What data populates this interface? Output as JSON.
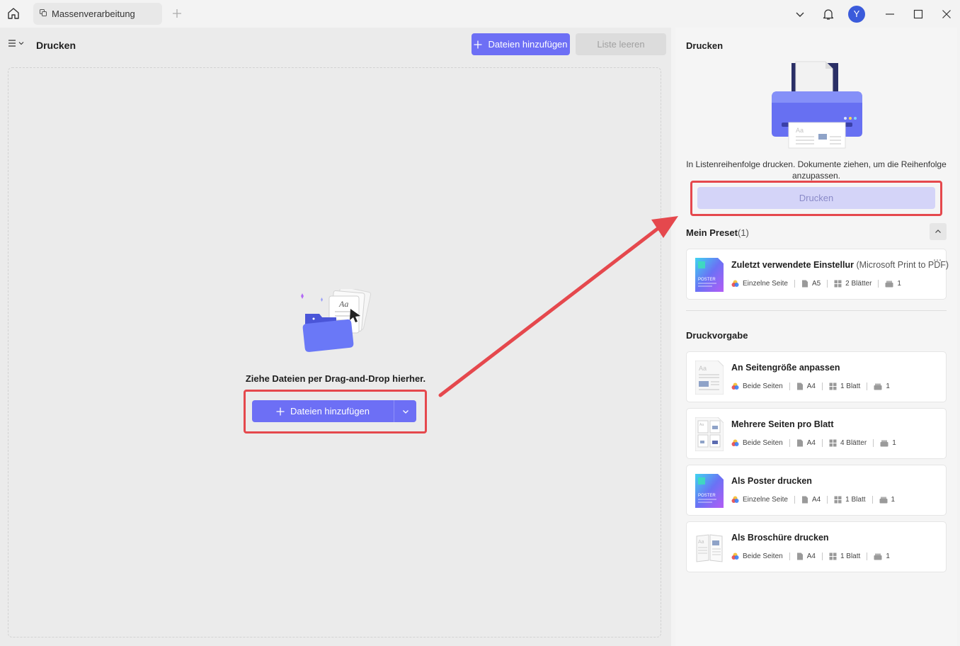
{
  "titlebar": {
    "tab_label": "Massenverarbeitung",
    "avatar_letter": "Y"
  },
  "left": {
    "page_title": "Drucken",
    "add_files_label": "Dateien hinzufügen",
    "clear_list_label": "Liste leeren",
    "drop_text": "Ziehe Dateien per Drag-and-Drop hierher.",
    "add_files_main_label": "Dateien hinzufügen"
  },
  "right": {
    "title": "Drucken",
    "description": "In Listenreihenfolge drucken. Dokumente ziehen, um die Reihenfolge anzupassen.",
    "print_label": "Drucken",
    "preset_title": "Mein Preset",
    "preset_count": "(1)",
    "presets": [
      {
        "name": "Zuletzt verwendete Einstellur",
        "printer": "(Microsoft Print to PDF)",
        "sides": "Einzelne Seite",
        "size": "A5",
        "sheets": "2 Blätter",
        "copies": "1"
      }
    ],
    "template_title": "Druckvorgabe",
    "templates": [
      {
        "name": "An Seitengröße anpassen",
        "sides": "Beide Seiten",
        "size": "A4",
        "sheets": "1 Blatt",
        "copies": "1"
      },
      {
        "name": "Mehrere Seiten pro Blatt",
        "sides": "Beide Seiten",
        "size": "A4",
        "sheets": "4 Blätter",
        "copies": "1"
      },
      {
        "name": "Als Poster drucken",
        "sides": "Einzelne Seite",
        "size": "A4",
        "sheets": "1 Blatt",
        "copies": "1"
      },
      {
        "name": "Als Broschüre drucken",
        "sides": "Beide Seiten",
        "size": "A4",
        "sheets": "1 Blatt",
        "copies": "1"
      }
    ]
  },
  "colors": {
    "accent": "#6d6ff5",
    "highlight": "#e5484d",
    "avatar": "#3b5bdb"
  },
  "icons": [
    "home-icon",
    "tab-icon",
    "plus-icon",
    "chevron-down-icon",
    "bell-icon",
    "minimize-icon",
    "maximize-icon",
    "close-icon",
    "menu-icon",
    "chevron-up-icon",
    "color-icon",
    "page-icon",
    "layout-icon",
    "copies-icon",
    "more-icon"
  ]
}
